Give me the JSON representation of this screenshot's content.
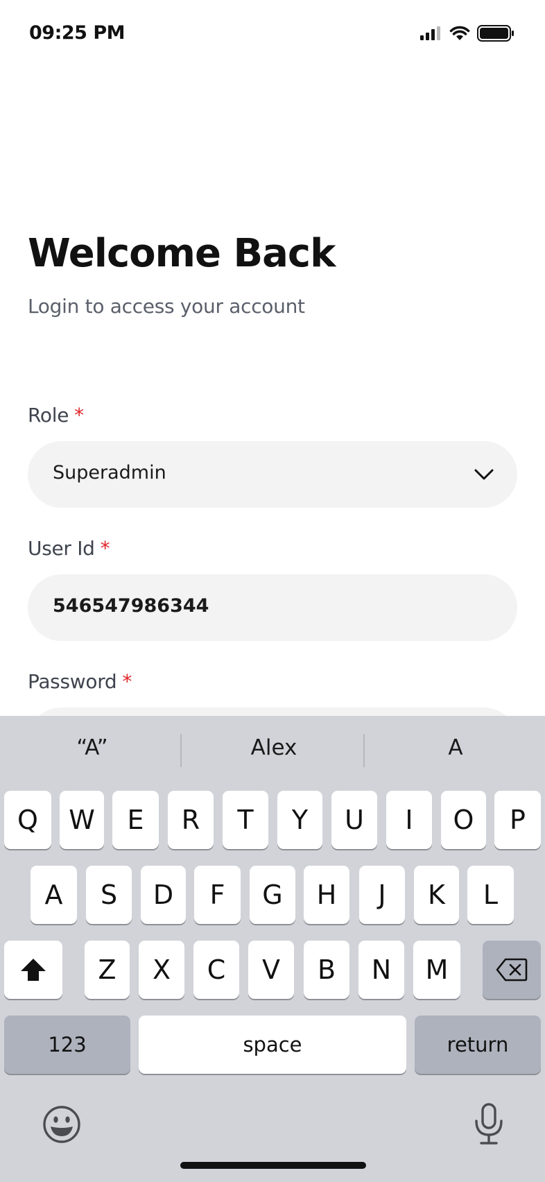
{
  "status_bar": {
    "time": "09:25 PM"
  },
  "header": {
    "title": "Welcome Back",
    "subtitle": "Login to access your account"
  },
  "form": {
    "required_marker": "*",
    "role": {
      "label": "Role",
      "value": "Superadmin"
    },
    "user_id": {
      "label": "User Id",
      "value": "546547986344"
    },
    "password": {
      "label": "Password"
    }
  },
  "keyboard": {
    "suggestions": [
      "“A”",
      "Alex",
      "A"
    ],
    "row1": [
      "Q",
      "W",
      "E",
      "R",
      "T",
      "Y",
      "U",
      "I",
      "O",
      "P"
    ],
    "row2": [
      "A",
      "S",
      "D",
      "F",
      "G",
      "H",
      "J",
      "K",
      "L"
    ],
    "row3": [
      "Z",
      "X",
      "C",
      "V",
      "B",
      "N",
      "M"
    ],
    "numbers_label": "123",
    "space_label": "space",
    "return_label": "return"
  },
  "colors": {
    "required": "#e0262b",
    "field_bg": "#f3f3f3",
    "keyboard_bg": "#d1d3d9"
  }
}
